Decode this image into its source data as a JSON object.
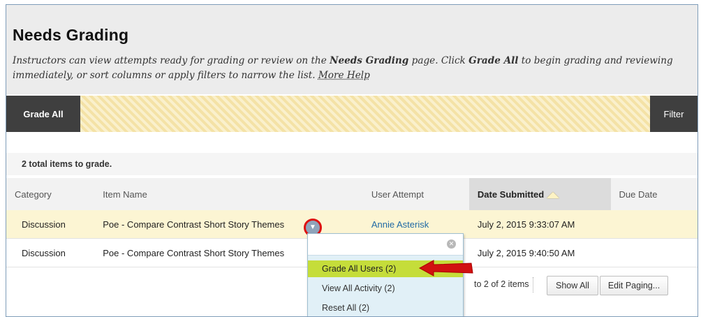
{
  "header": {
    "title": "Needs Grading",
    "desc_part1": "Instructors can view attempts ready for grading or review on the ",
    "desc_bold1": "Needs Grading",
    "desc_part2": " page. Click ",
    "desc_bold2": "Grade All",
    "desc_part3": " to begin grading and reviewing immediately, or sort columns or apply filters to narrow the list. ",
    "more_help": "More Help"
  },
  "toolbar": {
    "grade_all": "Grade All",
    "filter": "Filter"
  },
  "summary": {
    "total": "2 total items to grade."
  },
  "table": {
    "columns": [
      "Category",
      "Item Name",
      "User Attempt",
      "Date Submitted",
      "Due Date"
    ],
    "rows": [
      {
        "category": "Discussion",
        "item": "Poe - Compare Contrast Short Story Themes",
        "user": "Annie Asterisk",
        "date": "July 2, 2015 9:33:07 AM",
        "due": ""
      },
      {
        "category": "Discussion",
        "item": "Poe - Compare Contrast Short Story Themes",
        "user": "",
        "date": "July 2, 2015 9:40:50 AM",
        "due": ""
      }
    ]
  },
  "pager": {
    "range_text": "to 2 of 2 items",
    "show_all": "Show All",
    "edit_paging": "Edit Paging..."
  },
  "context_menu": {
    "items": [
      "Grade All Users (2)",
      "View All Activity (2)",
      "Reset All (2)"
    ]
  },
  "colors": {
    "toolbar_dark": "#3f3f3f",
    "highlight_row": "#fcf5d3",
    "menu_active": "#c5dd3a",
    "annotation_red": "#d11111",
    "link": "#1f6aa5"
  },
  "icons": {
    "sort": "sort-ascending-icon",
    "chevron": "chevron-down-icon",
    "close": "close-icon",
    "arrow": "annotation-arrow-icon"
  }
}
